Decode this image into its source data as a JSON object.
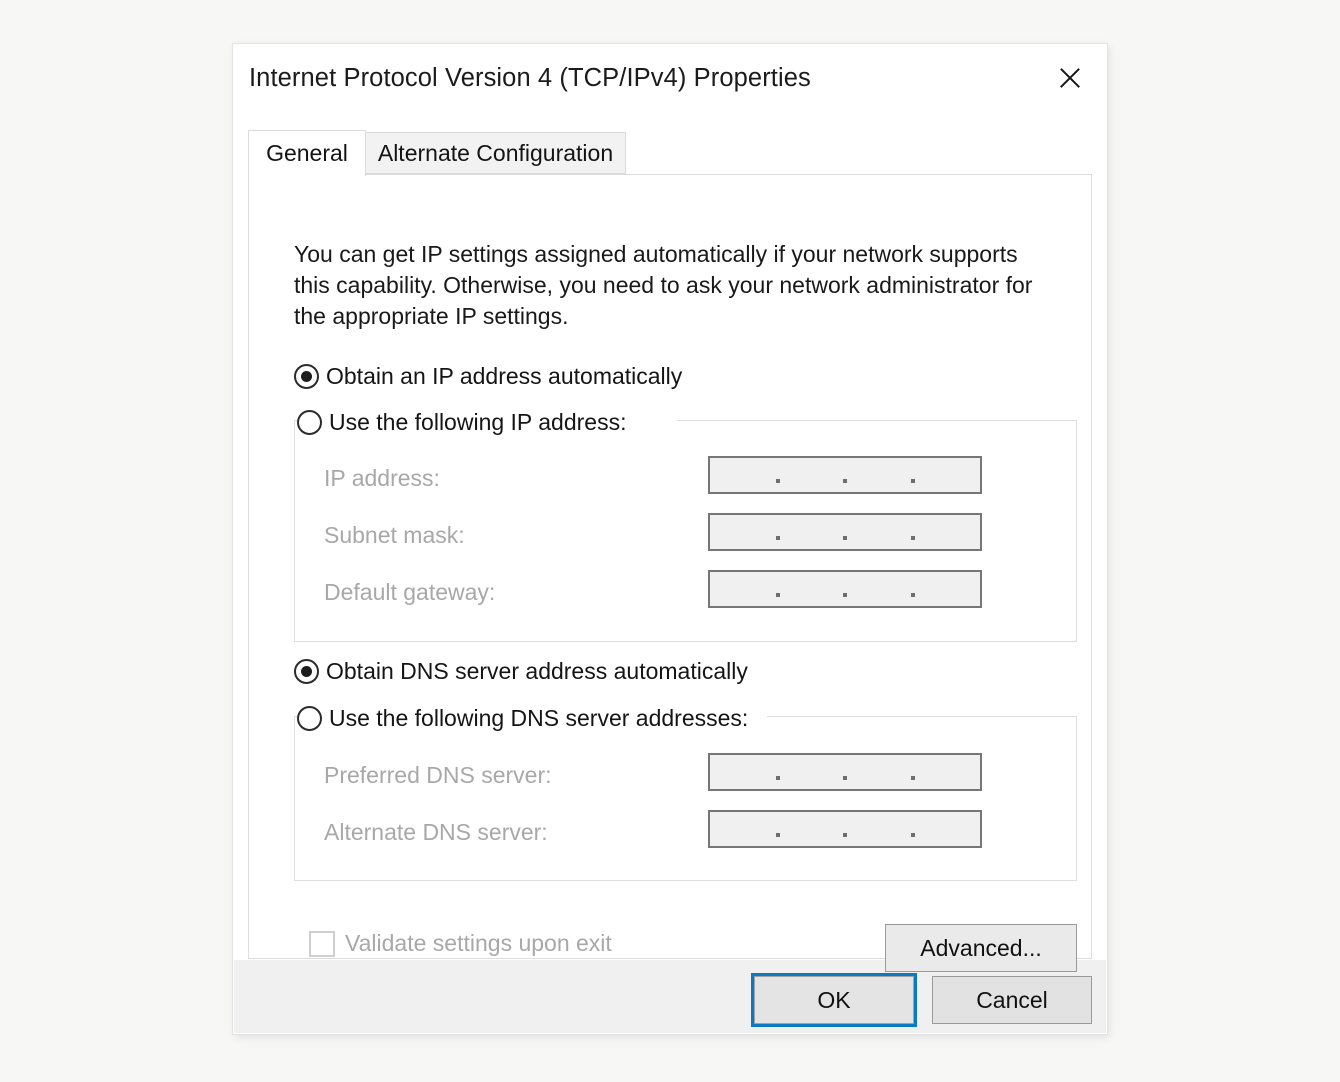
{
  "window": {
    "title": "Internet Protocol Version 4 (TCP/IPv4) Properties",
    "close_label": "Close"
  },
  "tabs": [
    {
      "label": "General",
      "active": true
    },
    {
      "label": "Alternate Configuration",
      "active": false
    }
  ],
  "general": {
    "intro": "You can get IP settings assigned automatically if your network supports this capability. Otherwise, you need to ask your network administrator for the appropriate IP settings.",
    "ip_mode": {
      "auto_label": "Obtain an IP address automatically",
      "auto_selected": true,
      "manual_label": "Use the following IP address:",
      "manual_selected": false,
      "fields": [
        {
          "label": "IP address:",
          "value": "",
          "enabled": false
        },
        {
          "label": "Subnet mask:",
          "value": "",
          "enabled": false
        },
        {
          "label": "Default gateway:",
          "value": "",
          "enabled": false
        }
      ]
    },
    "dns_mode": {
      "auto_label": "Obtain DNS server address automatically",
      "auto_selected": true,
      "manual_label": "Use the following DNS server addresses:",
      "manual_selected": false,
      "fields": [
        {
          "label": "Preferred DNS server:",
          "value": "",
          "enabled": false
        },
        {
          "label": "Alternate DNS server:",
          "value": "",
          "enabled": false
        }
      ]
    },
    "validate_checkbox": {
      "label": "Validate settings upon exit",
      "checked": false,
      "enabled": false
    },
    "advanced_button": "Advanced..."
  },
  "footer": {
    "ok_label": "OK",
    "cancel_label": "Cancel",
    "default_button": "OK"
  },
  "annotation": {
    "type": "arrow",
    "points_to": "Obtain DNS server address automatically",
    "direction": "left",
    "color": "#1c1c1c"
  },
  "colors": {
    "page_background": "#f7f7f5",
    "dialog_background": "#ffffff",
    "footer_background": "#f0f0f0",
    "focus_accent": "#0b7ac4",
    "disabled_text": "#a8a8a8",
    "body_text": "#151515",
    "field_fill": "#f0f0f0",
    "field_border": "#767676",
    "groupbox_border": "#dedede"
  }
}
